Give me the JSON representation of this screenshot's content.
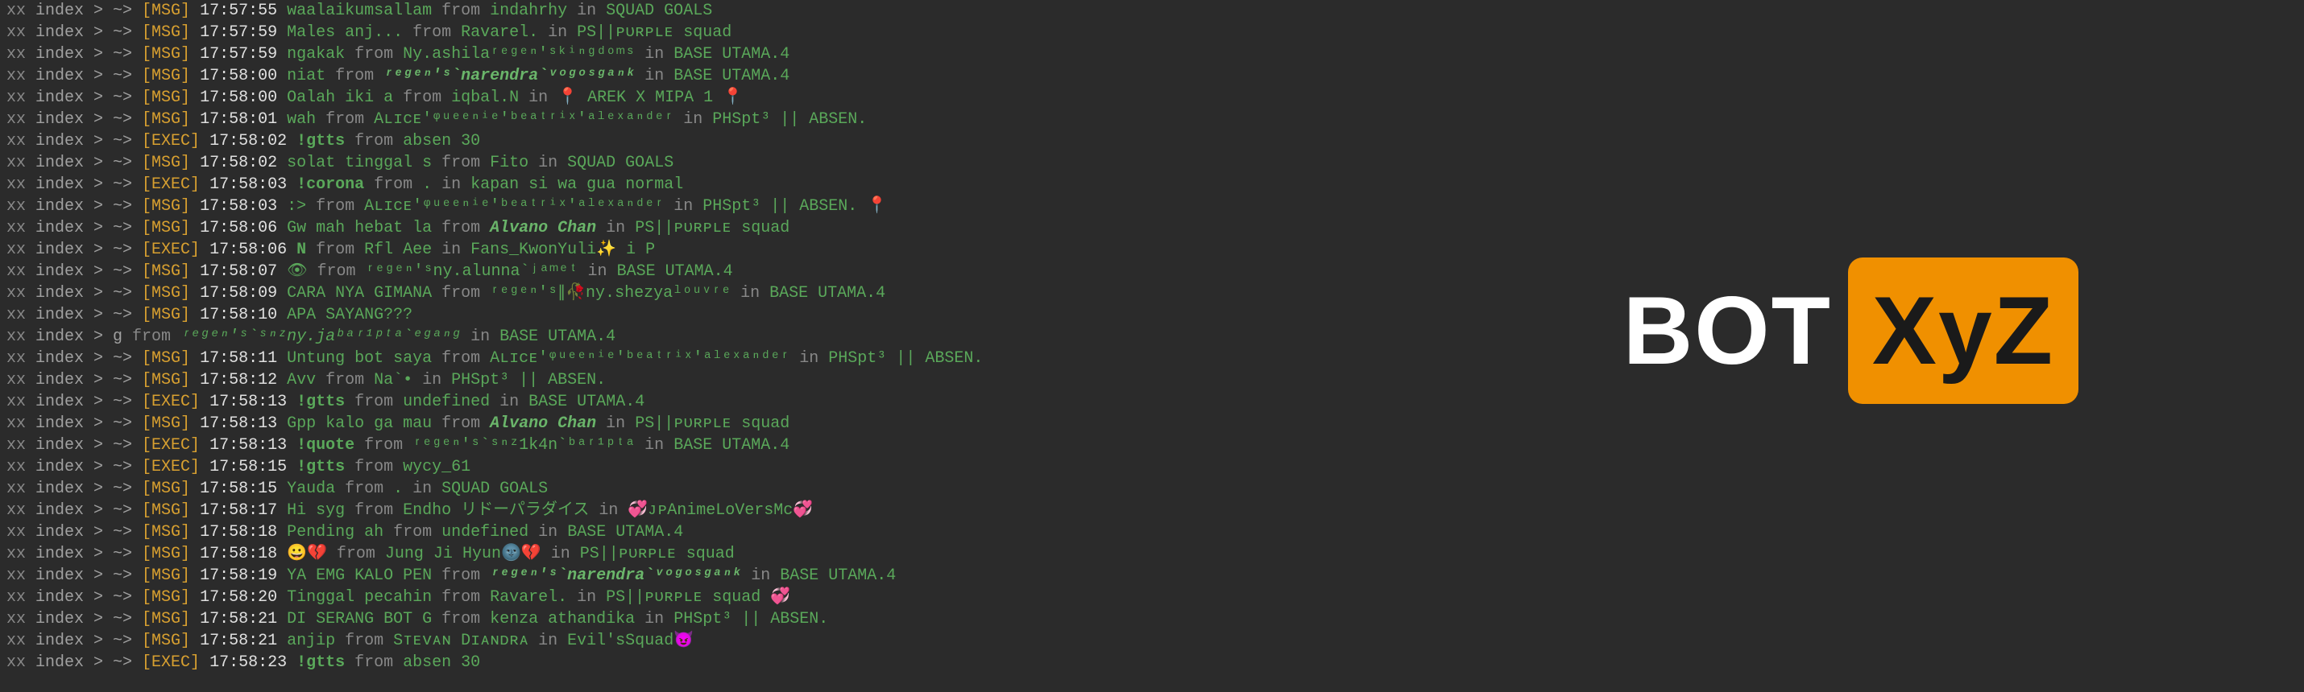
{
  "logo": {
    "text": "BOT",
    "badge": "XyZ"
  },
  "prefix": {
    "xx": "xx",
    "index": "index",
    "arrow1": ">",
    "tilde": "~>",
    "g": "g"
  },
  "tags": {
    "msg": "[MSG]",
    "exec": "[EXEC]"
  },
  "words": {
    "from": "from",
    "in": "in"
  },
  "lines": [
    {
      "tag": "MSG",
      "time": "17:57:55",
      "msg": "waalaikumsallam",
      "nick": "indahrhy",
      "room": "SQUAD GOALS"
    },
    {
      "tag": "MSG",
      "time": "17:57:59",
      "msg": "Males anj...",
      "nick": "Ravarel.",
      "room": "PS||ᴘᴜʀᴘʟᴇ squad"
    },
    {
      "tag": "MSG",
      "time": "17:57:59",
      "msg": "ngakak",
      "nick": "Ny.ashilaʳᵉᵍᵉⁿ'ˢᵏⁱⁿᵍᵈᵒᵐˢ",
      "room": "BASE UTAMA.4"
    },
    {
      "tag": "MSG",
      "time": "17:58:00",
      "msg": "niat",
      "nick": "ʳᵉᵍᵉⁿ'ˢ`narendra`ᵛᵒᵍᵒˢᵍᵃⁿᵏ",
      "nickBold": true,
      "room": "BASE UTAMA.4"
    },
    {
      "tag": "MSG",
      "time": "17:58:00",
      "msg": "Oalah iki a",
      "nick": "iqbal.N",
      "room": "📍 AREK  X MIPA 1 📍"
    },
    {
      "tag": "MSG",
      "time": "17:58:01",
      "msg": "wah",
      "nick": "Aʟɪᴄᴇ'ᵠᵘᵉᵉⁿⁱᵉ'ᵇᵉᵃᵗʳⁱˣ'ᵃˡᵉˣᵃⁿᵈᵉʳ",
      "room": "PHSpt³ || ABSEN."
    },
    {
      "tag": "EXEC",
      "time": "17:58:02",
      "msg": "!gtts",
      "nick": "absen 30",
      "noRoom": true
    },
    {
      "tag": "MSG",
      "time": "17:58:02",
      "msg": "solat tinggal s",
      "nick": "Fito",
      "room": "SQUAD GOALS"
    },
    {
      "tag": "EXEC",
      "time": "17:58:03",
      "msg": "!corona",
      "nick": ".",
      "room": "kapan si wa gua normal"
    },
    {
      "tag": "MSG",
      "time": "17:58:03",
      "msg": ":>",
      "nick": "Aʟɪᴄᴇ'ᵠᵘᵉᵉⁿⁱᵉ'ᵇᵉᵃᵗʳⁱˣ'ᵃˡᵉˣᵃⁿᵈᵉʳ",
      "room": "PHSpt³ || ABSEN.       📍"
    },
    {
      "tag": "MSG",
      "time": "17:58:06",
      "msg": "Gw mah hebat la",
      "nick": "Alvano Chan",
      "nickBold": true,
      "room": "PS||ᴘᴜʀᴘʟᴇ squad"
    },
    {
      "tag": "EXEC",
      "time": "17:58:06",
      "msg": "N",
      "nick": "Rfl Aee",
      "room": "Fans_KwonYuli✨      i  P"
    },
    {
      "tag": "MSG",
      "time": "17:58:07",
      "msg": "👁",
      "nick": "ʳᵉᵍᵉⁿ'ˢny.alunna`ʲᵃᵐᵉᵗ",
      "room": "BASE UTAMA.4"
    },
    {
      "tag": "MSG",
      "time": "17:58:09",
      "msg": "CARA NYA GIMANA",
      "nick": "ʳᵉᵍᵉⁿ'ˢ∥🥀ny.shezyaˡᵒᵘᵛʳᵉ",
      "room": "BASE UTAMA.4"
    },
    {
      "tag": "MSG",
      "time": "17:58:10",
      "msg": "APA SAYANG???",
      "noNick": true
    },
    {
      "tag": "RAW",
      "time": "",
      "raw": true,
      "msg": "",
      "nick": "ʳᵉᵍᵉⁿ'ˢ`ˢⁿᶻny.jaᵇᵃʳ¹ᵖᵗᵃ`ᵉᵍᵃⁿᵍ",
      "room": "BASE UTAMA.4"
    },
    {
      "tag": "MSG",
      "time": "17:58:11",
      "msg": "Untung bot saya",
      "nick": "Aʟɪᴄᴇ'ᵠᵘᵉᵉⁿⁱᵉ'ᵇᵉᵃᵗʳⁱˣ'ᵃˡᵉˣᵃⁿᵈᵉʳ",
      "room": "PHSpt³ || ABSEN."
    },
    {
      "tag": "MSG",
      "time": "17:58:12",
      "msg": "Avv",
      "nick": "Na`•",
      "room": "PHSpt³ || ABSEN."
    },
    {
      "tag": "EXEC",
      "time": "17:58:13",
      "msg": "!gtts",
      "nick": "undefined",
      "room": "BASE UTAMA.4"
    },
    {
      "tag": "MSG",
      "time": "17:58:13",
      "msg": "Gpp kalo ga mau",
      "nick": "Alvano Chan",
      "nickBold": true,
      "room": "PS||ᴘᴜʀᴘʟᴇ squad"
    },
    {
      "tag": "EXEC",
      "time": "17:58:13",
      "msg": "!quote",
      "nick": "ʳᵉᵍᵉⁿ'ˢ`ˢⁿᶻ1k4n`ᵇᵃʳ¹ᵖᵗᵃ",
      "room": "BASE UTAMA.4"
    },
    {
      "tag": "EXEC",
      "time": "17:58:15",
      "msg": "!gtts",
      "nick": "wycy_61",
      "noRoom": true
    },
    {
      "tag": "MSG",
      "time": "17:58:15",
      "msg": "Yauda",
      "nick": ".",
      "room": "SQUAD GOALS"
    },
    {
      "tag": "MSG",
      "time": "17:58:17",
      "msg": "Hi syg",
      "nick": "Endho  リドーパラダイス",
      "room": "💞ᴊᴘAnimeLoVersMc💞"
    },
    {
      "tag": "MSG",
      "time": "17:58:18",
      "msg": "Pending ah",
      "nick": "undefined",
      "room": "BASE UTAMA.4"
    },
    {
      "tag": "MSG",
      "time": "17:58:18",
      "msg": "😀💔",
      "nick": "Jung Ji Hyun🌚💔",
      "room": "PS||ᴘᴜʀᴘʟᴇ squad"
    },
    {
      "tag": "MSG",
      "time": "17:58:19",
      "msg": "YA EMG KALO PEN",
      "nick": "ʳᵉᵍᵉⁿ'ˢ`narendra`ᵛᵒᵍᵒˢᵍᵃⁿᵏ",
      "nickBold": true,
      "room": "BASE UTAMA.4"
    },
    {
      "tag": "MSG",
      "time": "17:58:20",
      "msg": "Tinggal pecahin",
      "nick": "Ravarel.",
      "room": "PS||ᴘᴜʀᴘʟᴇ squad     💞"
    },
    {
      "tag": "MSG",
      "time": "17:58:21",
      "msg": "DI SERANG BOT G",
      "nick": "kenza athandika",
      "room": "PHSpt³ || ABSEN."
    },
    {
      "tag": "MSG",
      "time": "17:58:21",
      "msg": "anjip",
      "nick": "Sᴛᴇᴠᴀɴ Dɪᴀɴᴅʀᴀ",
      "room": "Evil'sSquad😈"
    },
    {
      "tag": "EXEC",
      "time": "17:58:23",
      "msg": "!gtts",
      "nick": "absen 30",
      "noRoom": true
    }
  ]
}
